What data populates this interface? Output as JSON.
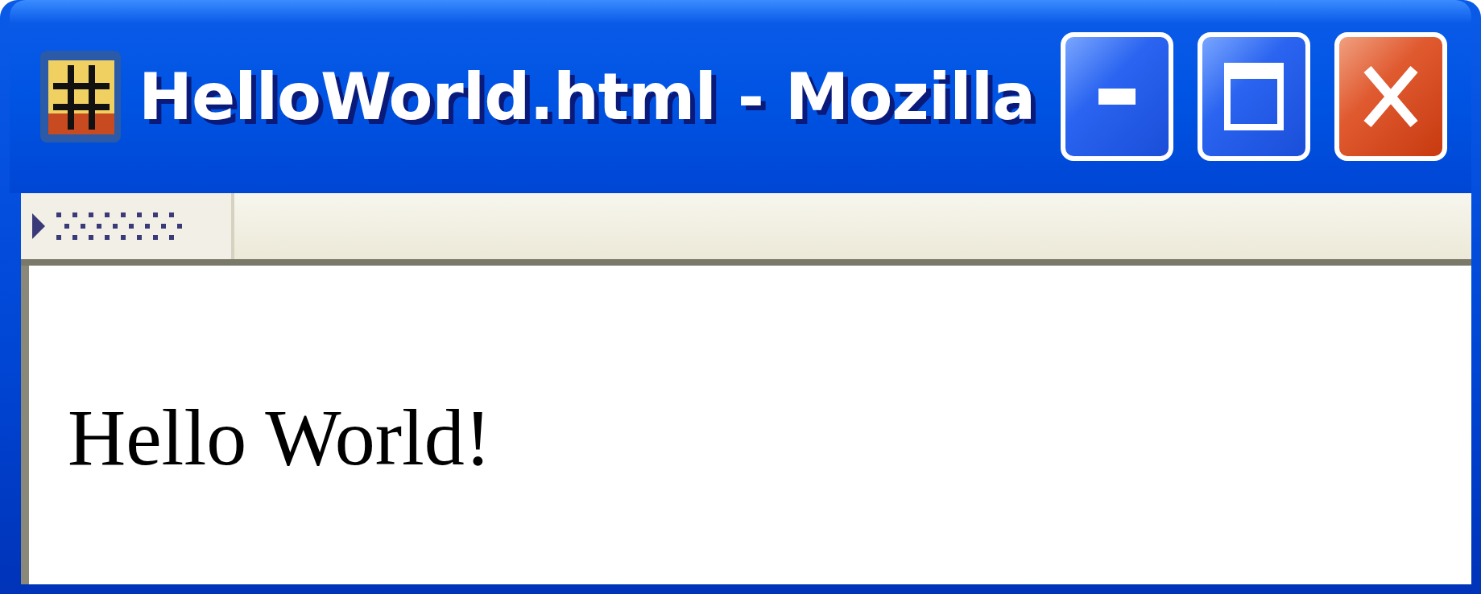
{
  "window": {
    "title": "HelloWorld.html - Mozilla"
  },
  "content": {
    "text": "Hello World!"
  }
}
